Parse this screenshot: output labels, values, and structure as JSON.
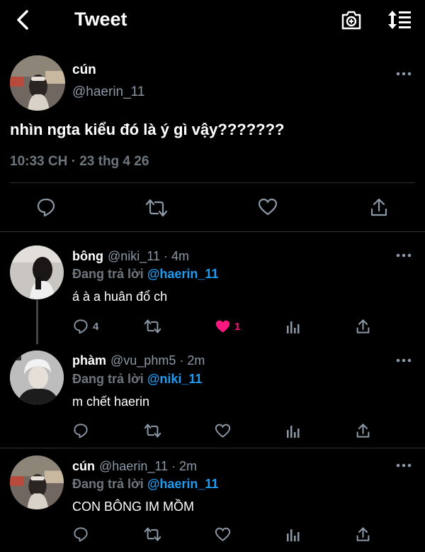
{
  "header": {
    "title": "Tweet"
  },
  "main_tweet": {
    "name": "cún",
    "handle": "@haerin_11",
    "text": "nhìn ngta kiểu đó là ý gì vậy???????",
    "timestamp": "10:33 CH · 23 thg 4 26"
  },
  "replies": [
    {
      "name": "bông",
      "meta": "@niki_11 · 4m",
      "replying_label": "Đang trả lời",
      "replying_to": "@haerin_11",
      "text": "á à a huân đổ ch",
      "reply_count": "4",
      "like_count": "1",
      "liked": true
    },
    {
      "name": "phàm",
      "meta": "@vu_phm5 · 2m",
      "replying_label": "Đang trả lời",
      "replying_to": "@niki_11",
      "text": "m chết haerin"
    },
    {
      "name": "cún",
      "meta": "@haerin_11 · 2m",
      "replying_label": "Đang trả lời",
      "replying_to": "@haerin_11",
      "text": "CON BÔNG IM MỒM"
    }
  ],
  "colors": {
    "accent": "#1d9bf0",
    "like": "#f91880",
    "muted": "#6e767d",
    "background": "#000000"
  }
}
